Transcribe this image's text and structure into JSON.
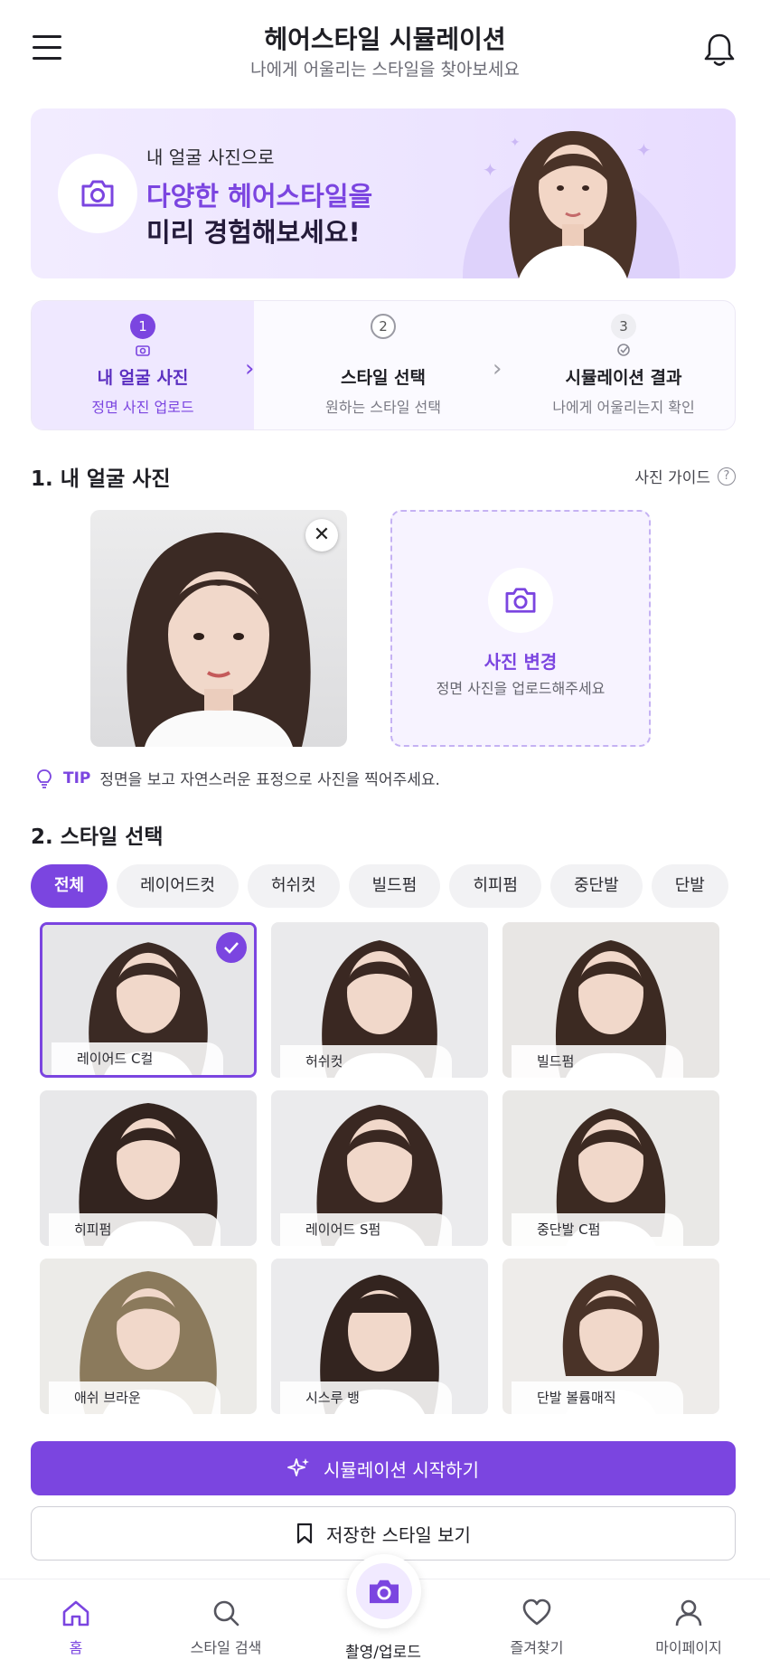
{
  "header": {
    "title": "헤어스타일 시뮬레이션",
    "subtitle": "나에게 어울리는 스타일을 찾아보세요"
  },
  "hero": {
    "small": "내 얼굴 사진으로",
    "line1": "다양한 헤어스타일을",
    "line2": "미리 경험해보세요!"
  },
  "steps": [
    {
      "num": "1",
      "label": "내 얼굴 사진",
      "desc": "정면 사진 업로드",
      "active": true
    },
    {
      "num": "2",
      "label": "스타일 선택",
      "desc": "원하는 스타일 선택",
      "active": false
    },
    {
      "num": "3",
      "label": "시뮬레이션 결과",
      "desc": "나에게 어울리는지 확인",
      "active": false
    }
  ],
  "section1": {
    "title": "1. 내 얼굴 사진",
    "guide": "사진 가이드",
    "change_label": "사진 변경",
    "change_desc": "정면 사진을 업로드해주세요",
    "tip_label": "TIP",
    "tip_text": "정면을 보고 자연스러운 표정으로 사진을 찍어주세요."
  },
  "section2": {
    "title": "2. 스타일 선택",
    "chips": [
      "전체",
      "레이어드컷",
      "허쉬컷",
      "빌드펌",
      "히피펌",
      "중단발",
      "단발"
    ],
    "selected_chip": "전체"
  },
  "styles": [
    {
      "label": "레이어드 C컬",
      "selected": true
    },
    {
      "label": "허쉬컷",
      "selected": false
    },
    {
      "label": "빌드펌",
      "selected": false
    },
    {
      "label": "히피펌",
      "selected": false
    },
    {
      "label": "레이어드 S펌",
      "selected": false
    },
    {
      "label": "중단발 C펌",
      "selected": false
    },
    {
      "label": "애쉬 브라운",
      "selected": false
    },
    {
      "label": "시스루 뱅",
      "selected": false
    },
    {
      "label": "단발 볼륨매직",
      "selected": false
    }
  ],
  "actions": {
    "primary": "시뮬레이션 시작하기",
    "secondary": "저장한 스타일 보기"
  },
  "nav": {
    "home": "홈",
    "search": "스타일 검색",
    "capture": "촬영/업로드",
    "favorites": "즐겨찾기",
    "mypage": "마이페이지"
  },
  "colors": {
    "accent": "#7b45e0",
    "accent_light": "#efe8ff"
  }
}
